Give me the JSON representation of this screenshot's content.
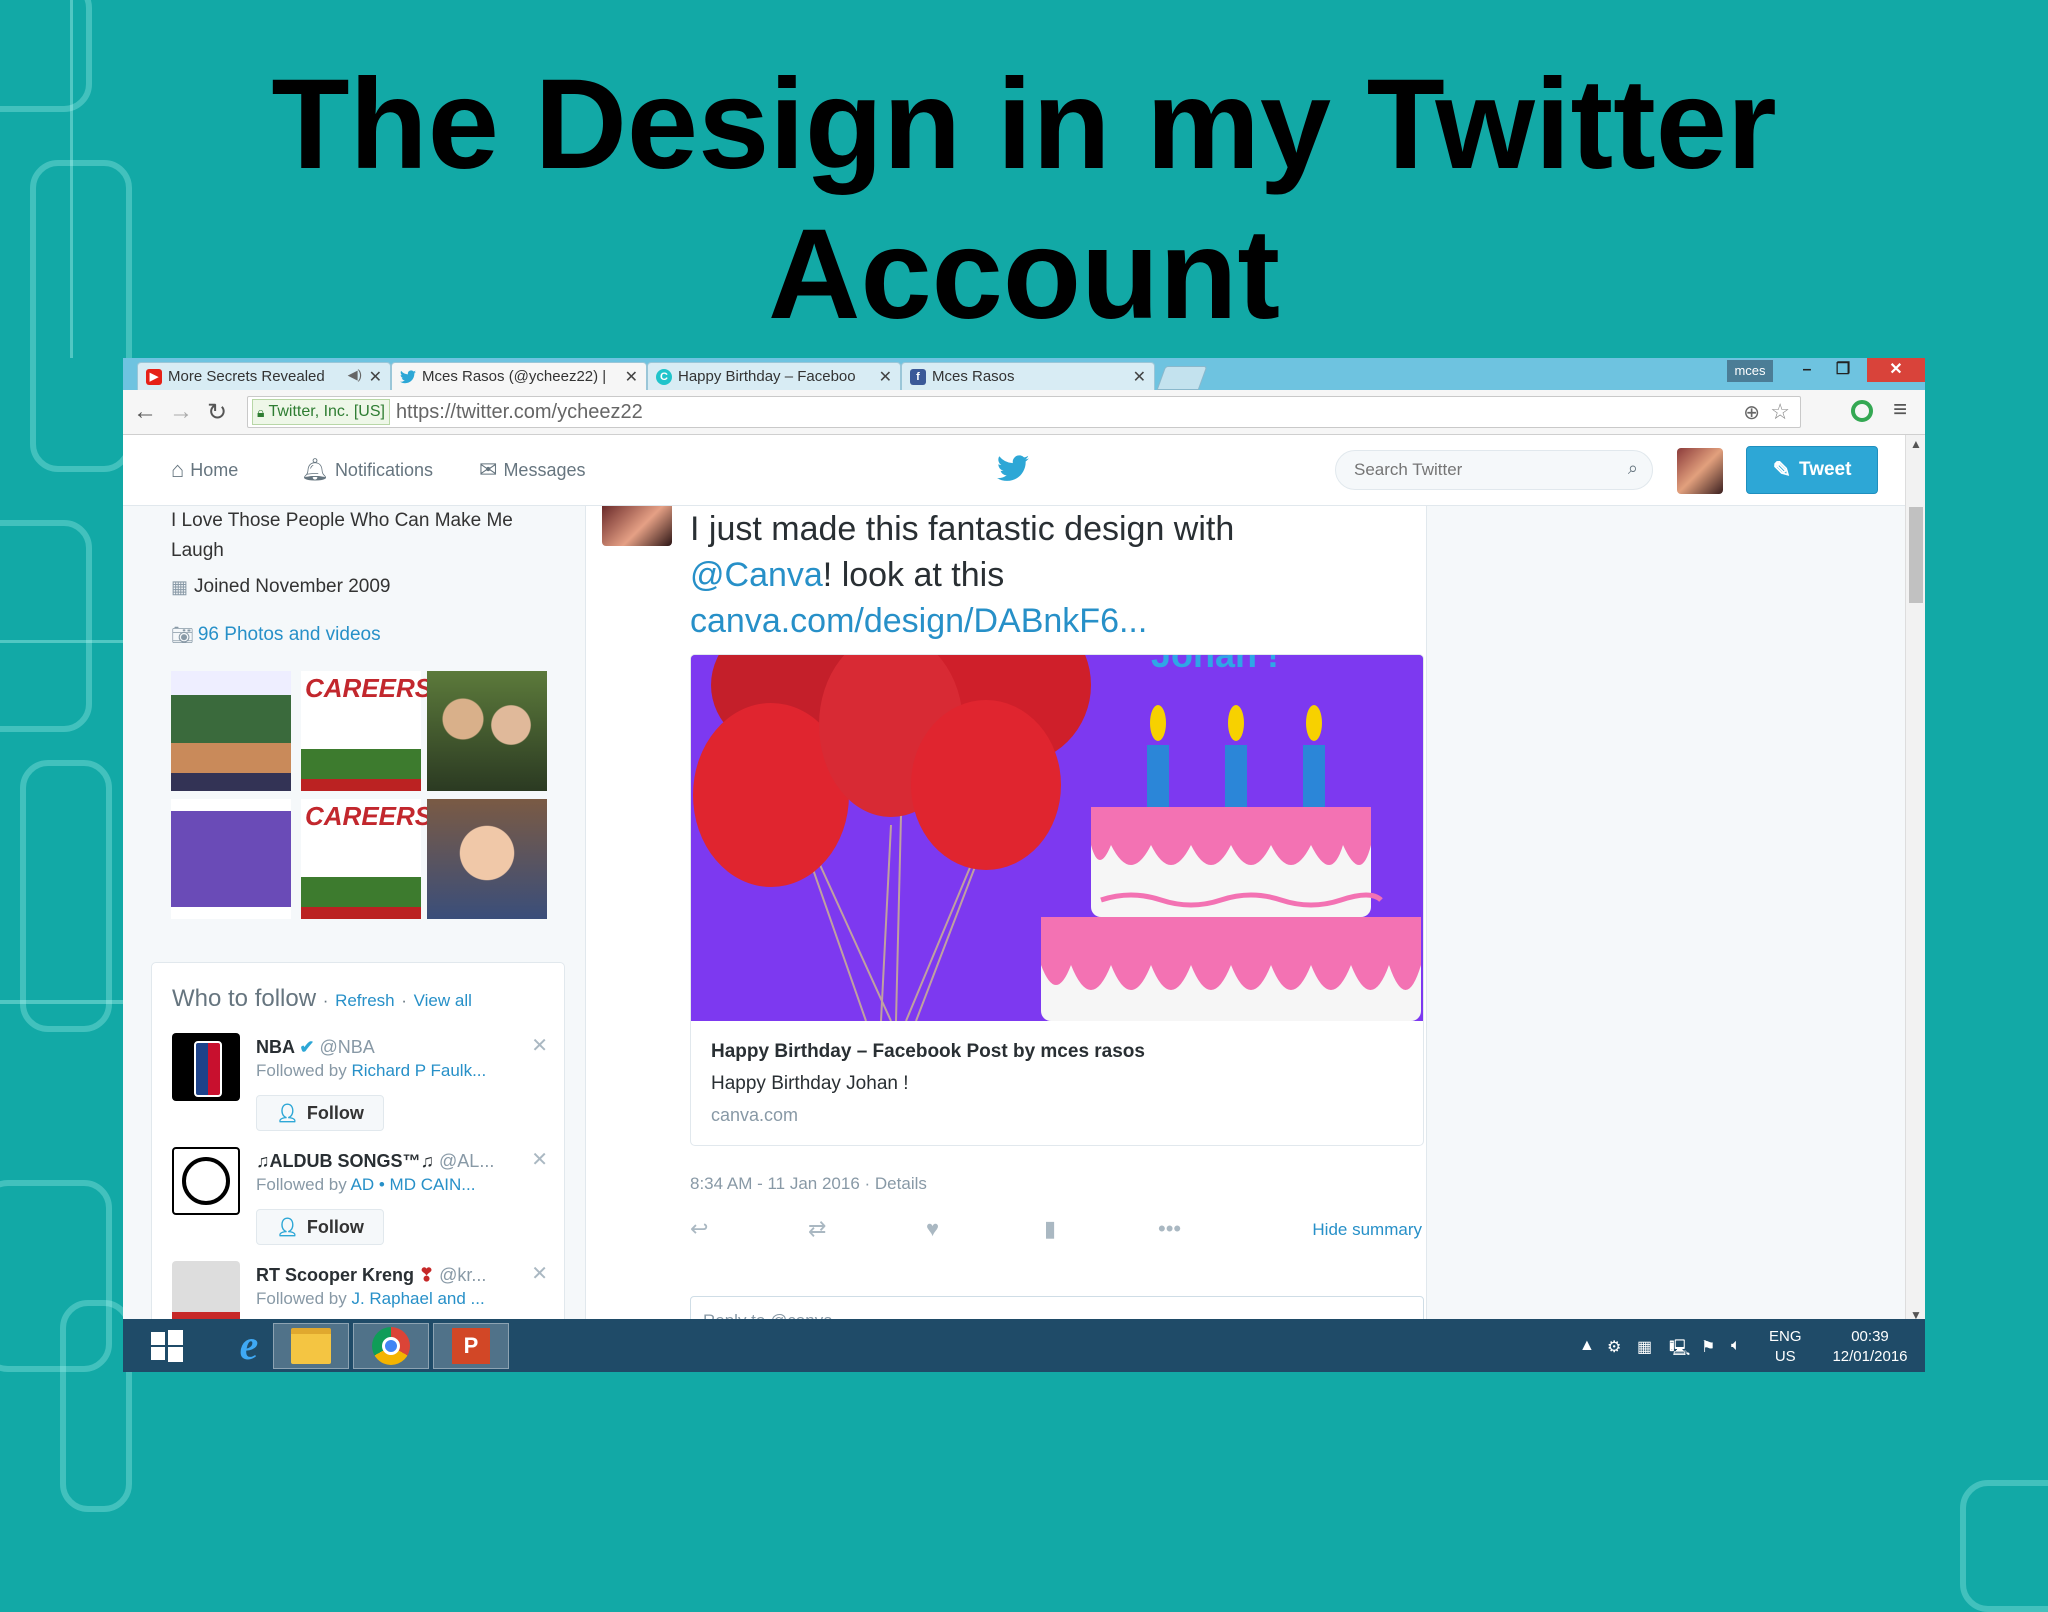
{
  "slide": {
    "title": "The Design in my Twitter Account"
  },
  "browser": {
    "tabs": [
      {
        "label": "More Secrets Revealed",
        "icon": "youtube-icon"
      },
      {
        "label": "Mces Rasos (@ycheez22) |",
        "icon": "twitter-icon"
      },
      {
        "label": "Happy Birthday – Faceboo",
        "icon": "canva-icon"
      },
      {
        "label": "Mces Rasos",
        "icon": "facebook-icon"
      }
    ],
    "profile_badge": "mces",
    "security_label": "Twitter, Inc. [US]",
    "url_prefix": "https://twitter.com/",
    "url_path": "ycheez22"
  },
  "twitter_nav": {
    "home": "Home",
    "notifications": "Notifications",
    "messages": "Messages",
    "search_placeholder": "Search Twitter",
    "tweet_button": "Tweet"
  },
  "profile": {
    "bio": "I Love Those People Who Can Make Me Laugh",
    "joined": "Joined November 2009",
    "photos_link": "96 Photos and videos"
  },
  "who_to_follow": {
    "title": "Who to follow",
    "refresh": "Refresh",
    "view_all": "View all",
    "separator": "·",
    "follow_label": "Follow",
    "suggestions": [
      {
        "name": "NBA",
        "handle": "@NBA",
        "followed_by_prefix": "Followed by",
        "followed_by": "Richard P Faulk..."
      },
      {
        "name": "♫ALDUB SONGS™♫",
        "handle": "@AL...",
        "followed_by_prefix": "Followed by",
        "followed_by": "AD • MD CAIN..."
      },
      {
        "name": "RT Scooper Kreng",
        "handle": "@kr...",
        "followed_by_prefix": "Followed by",
        "followed_by": "J. Raphael and ..."
      }
    ]
  },
  "tweet": {
    "text_1": "I just made this fantastic design with",
    "mention": "@Canva",
    "text_2": "! look at this",
    "link": "canva.com/design/DABnkF6...",
    "card": {
      "image_text": "Johan !",
      "title": "Happy Birthday – Facebook Post by mces rasos",
      "description": "Happy Birthday Johan !",
      "domain": "canva.com"
    },
    "timestamp": "8:34 AM - 11 Jan 2016 · Details",
    "hide_summary": "Hide summary",
    "reply_placeholder": "Reply to @canva"
  },
  "taskbar": {
    "language": "ENG",
    "region": "US",
    "time": "00:39",
    "date": "12/01/2016"
  },
  "colors": {
    "background": "#12a9a6",
    "twitter_blue": "#2790c8",
    "card_purple": "#7d39f0"
  }
}
